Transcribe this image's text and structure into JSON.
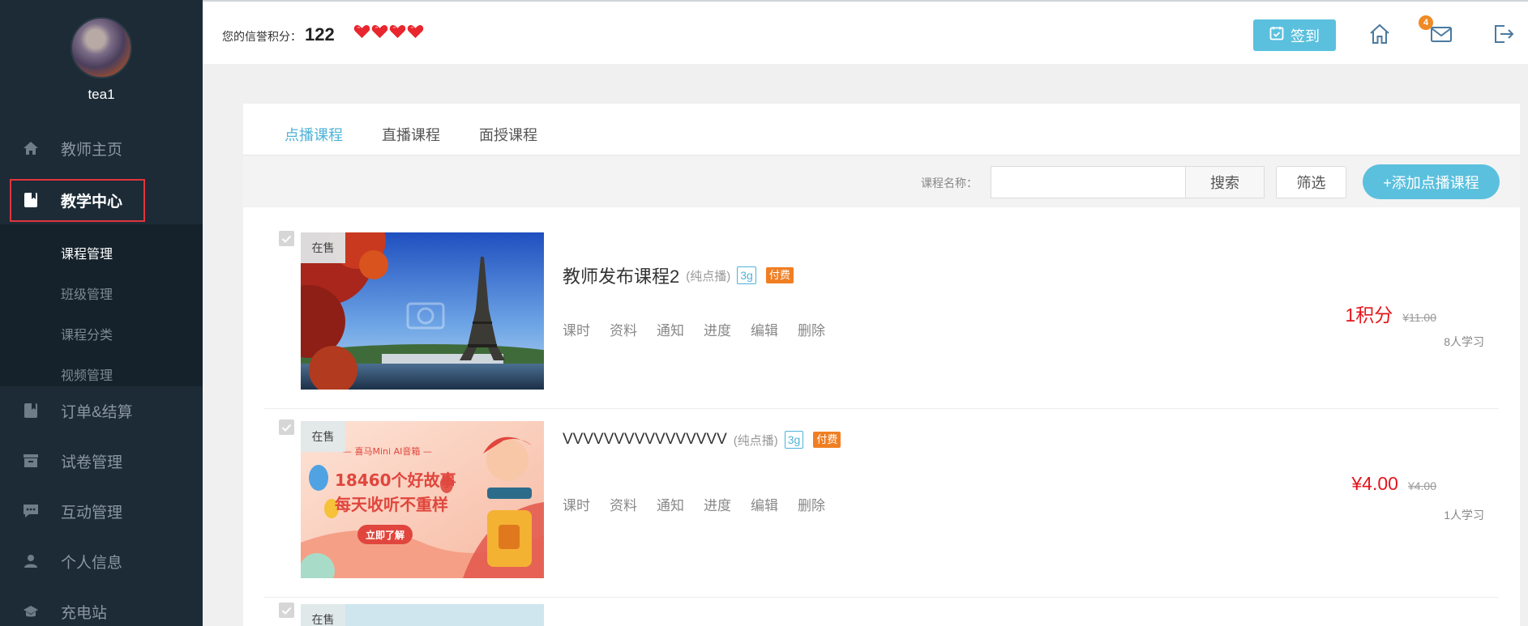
{
  "colors": {
    "sidebar_bg": "#1c2b36",
    "accent": "#5bc0de",
    "price_red": "#e4151b",
    "paid_orange": "#f07f24",
    "highlight_box": "#e2353d"
  },
  "sidebar": {
    "username": "tea1",
    "items": [
      {
        "label": "教师主页",
        "icon": "home-icon"
      },
      {
        "label": "教学中心",
        "icon": "book-icon"
      },
      {
        "label": "订单&结算",
        "icon": "book-icon"
      },
      {
        "label": "试卷管理",
        "icon": "archive-icon"
      },
      {
        "label": "互动管理",
        "icon": "chat-icon"
      },
      {
        "label": "个人信息",
        "icon": "user-icon"
      },
      {
        "label": "充电站",
        "icon": "graduation-cap-icon"
      }
    ],
    "submenu": [
      {
        "label": "课程管理"
      },
      {
        "label": "班级管理"
      },
      {
        "label": "课程分类"
      },
      {
        "label": "视频管理"
      }
    ]
  },
  "header": {
    "credit_label": "您的信誉积分：",
    "credit_value": "122",
    "hearts": 4,
    "signin_label": "签到",
    "mail_badge": "4"
  },
  "tabs": [
    {
      "label": "点播课程"
    },
    {
      "label": "直播课程"
    },
    {
      "label": "面授课程"
    }
  ],
  "toolbar": {
    "search_label": "课程名称：",
    "search_value": "",
    "search_button": "搜索",
    "filter_button": "筛选",
    "add_button": "+添加点播课程"
  },
  "courses": [
    {
      "status": "在售",
      "title": "教师发布课程2",
      "kind": "(纯点播)",
      "size": "3g",
      "paid": "付费",
      "ops": [
        "课时",
        "资料",
        "通知",
        "进度",
        "编辑",
        "删除"
      ],
      "price": "1积分",
      "old_price": "¥11.00",
      "learners": "8人学习"
    },
    {
      "status": "在售",
      "title": "VVVVVVVVVVVVVVVV",
      "kind": "(纯点播)",
      "size": "3g",
      "paid": "付费",
      "ops": [
        "课时",
        "资料",
        "通知",
        "进度",
        "编辑",
        "删除"
      ],
      "price": "¥4.00",
      "old_price": "¥4.00",
      "learners": "1人学习"
    }
  ],
  "banner2": {
    "brand": "— 喜马Mini AI音箱 —",
    "line1": "18460个好故事",
    "line2": "每天收听不重样",
    "cta": "立即了解"
  }
}
